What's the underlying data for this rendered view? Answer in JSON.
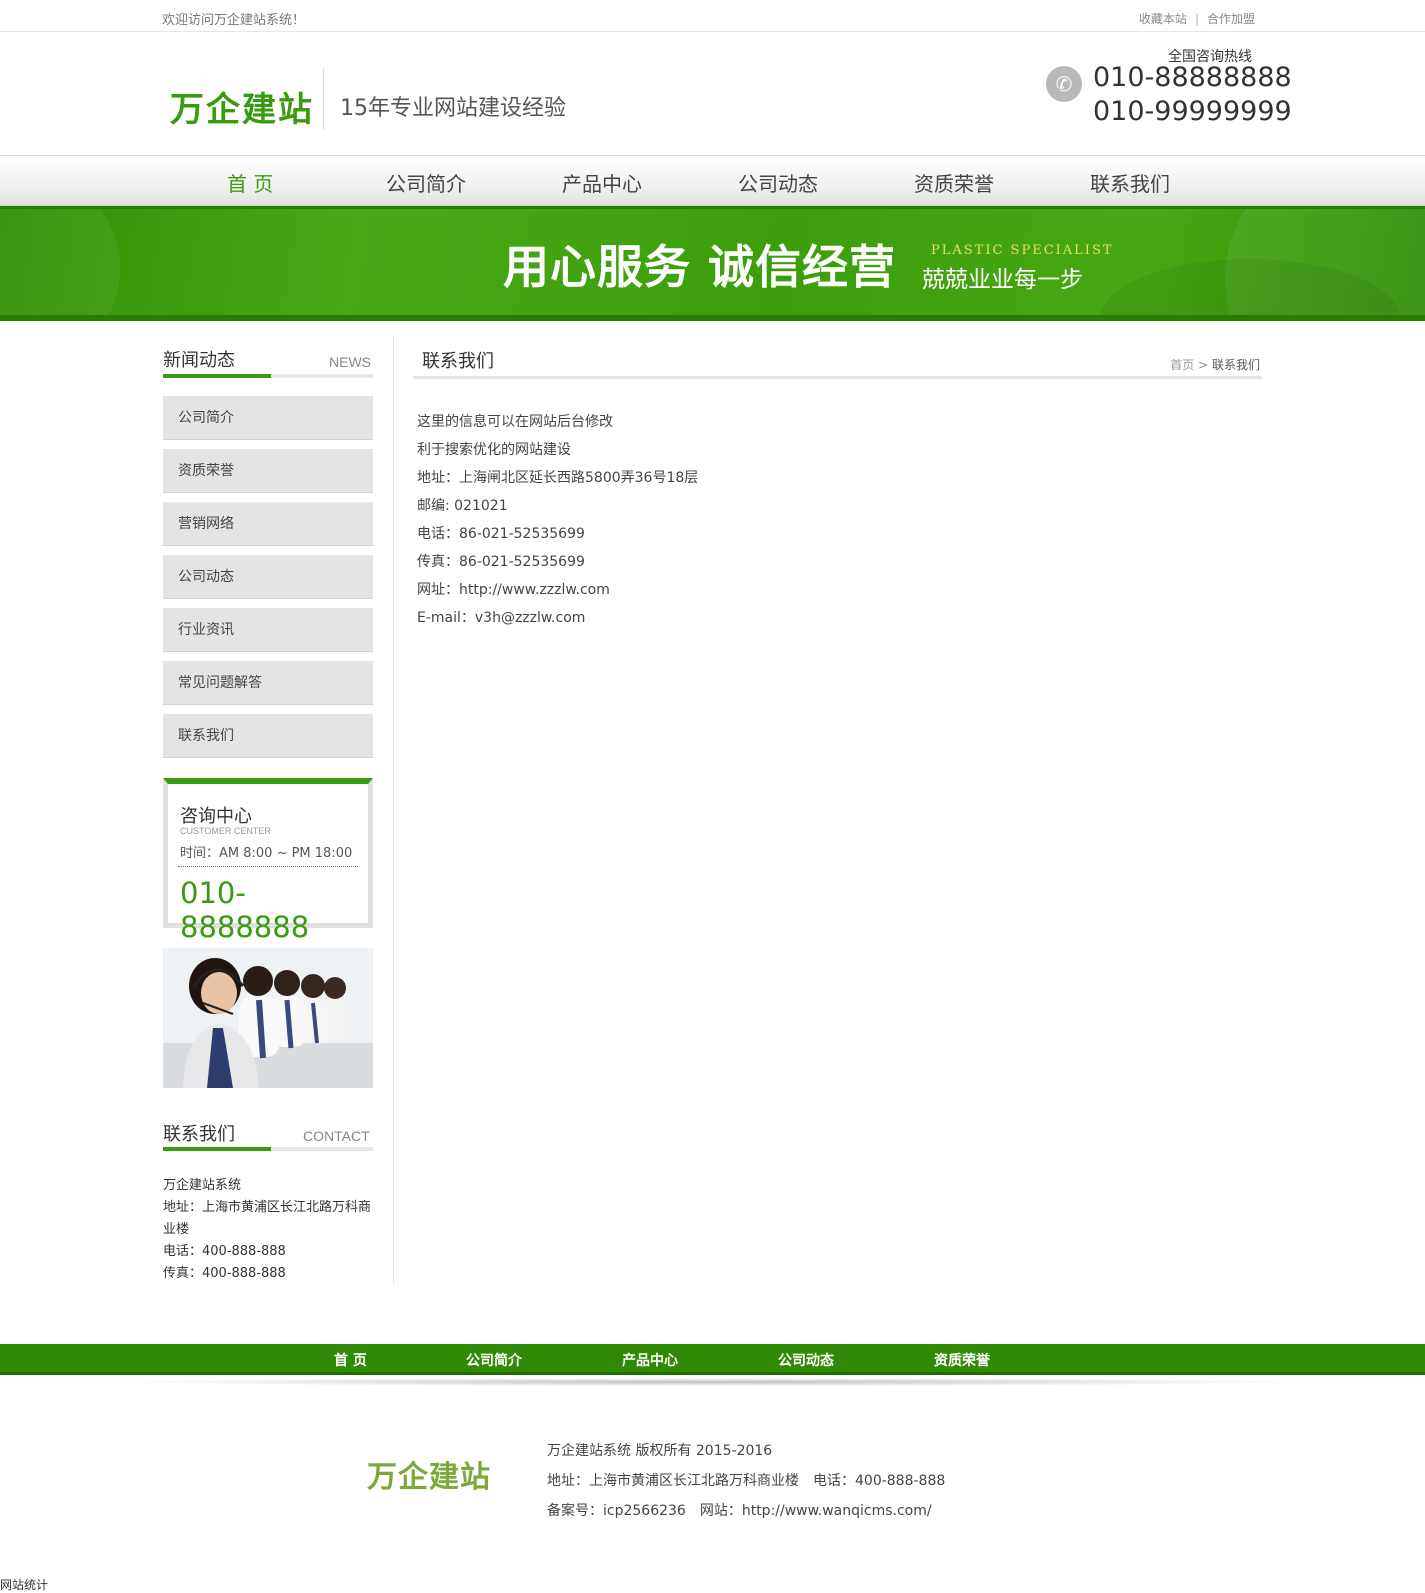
{
  "topbar": {
    "welcome": "欢迎访问万企建站系统！",
    "bookmark": "收藏本站",
    "separator": "|",
    "partner": "合作加盟"
  },
  "header": {
    "logo": "万企建站",
    "slogan": "15年专业网站建设经验",
    "hotline_label": "全国咨询热线",
    "hotline_1": "010-88888888",
    "hotline_2": "010-99999999"
  },
  "nav": {
    "items": [
      "首 页",
      "公司简介",
      "产品中心",
      "公司动态",
      "资质荣誉",
      "联系我们"
    ],
    "active": "首 页"
  },
  "banner": {
    "main": "用心服务 诚信经营",
    "english": "PLASTIC SPECIALIST",
    "sub": "兢兢业业每一步"
  },
  "sidebar": {
    "news_title": "新闻动态",
    "news_en": "NEWS",
    "menu": [
      "公司简介",
      "资质荣誉",
      "营销网络",
      "公司动态",
      "行业资讯",
      "常见问题解答",
      "联系我们"
    ],
    "consult": {
      "title": "咨询中心",
      "en": "CUSTOMER CENTER",
      "time": "时间：AM 8:00 ~ PM 18:00",
      "phone": "010-8888888"
    },
    "contact_title": "联系我们",
    "contact_en": "CONTACT",
    "contact_lines": [
      "万企建站系统",
      "地址：上海市黄浦区长江北路万科商业楼",
      "电话：400-888-888",
      "传真：400-888-888"
    ]
  },
  "main": {
    "title": "联系我们",
    "breadcrumb_home": "首页",
    "breadcrumb_sep": ">",
    "breadcrumb_current": "联系我们",
    "content_lines": [
      "这里的信息可以在网站后台修改",
      "利于搜索优化的网站建设",
      " 地址：上海闸北区延长西路5800弄36号18层",
      " 邮编: 021021",
      "电话：86-021-52535699",
      "传真：86-021-52535699",
      "网址：http://www.zzzlw.com",
      " E-mail：v3h@zzzlw.com"
    ]
  },
  "footer": {
    "nav": [
      "首 页",
      "公司简介",
      "产品中心",
      "公司动态",
      "资质荣誉"
    ],
    "logo": "万企建站",
    "copyright": "万企建站系统 版权所有 2015-2016",
    "address": "地址：上海市黄浦区长江北路万科商业楼",
    "phone": "电话：400-888-888",
    "icp": "备案号：icp2566236",
    "website": "网站：http://www.wanqicms.com/",
    "stat": "网站统计"
  },
  "colors": {
    "brand_green": "#3a9a10",
    "dark_green": "#2f8a06"
  }
}
